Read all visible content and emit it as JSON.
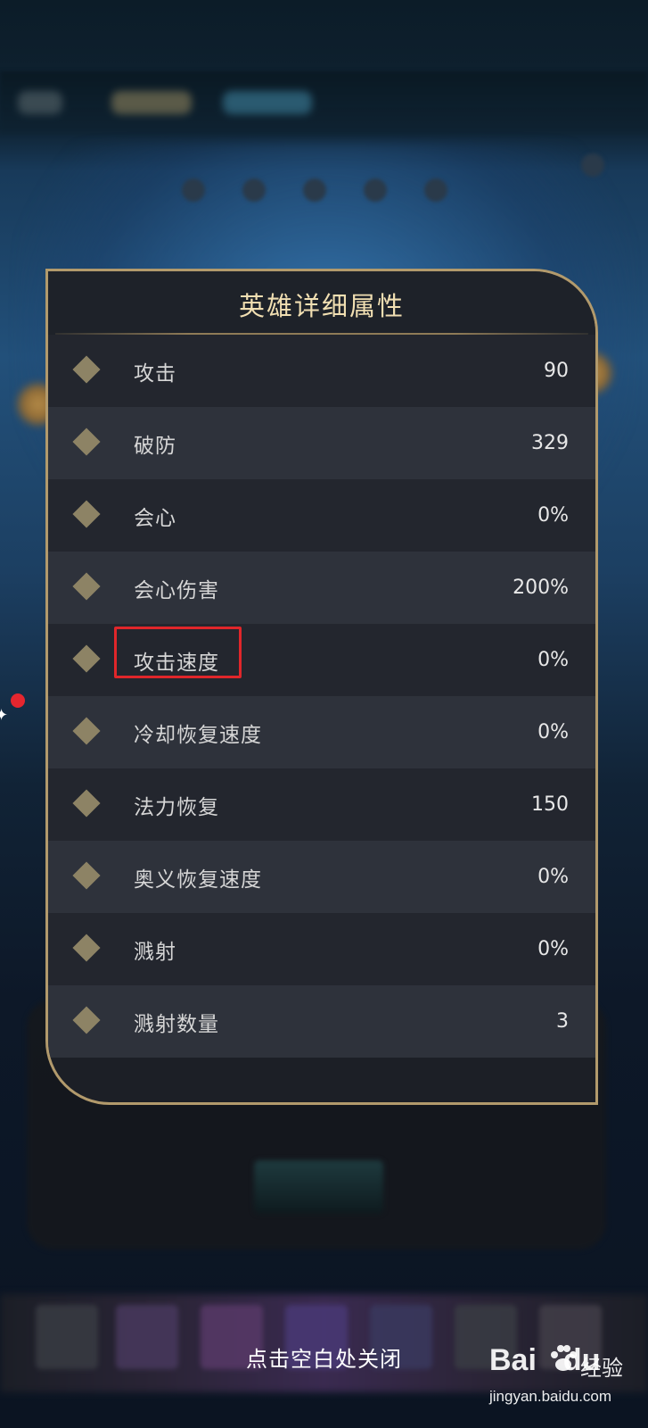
{
  "panel": {
    "title": "英雄详细属性",
    "rows": [
      {
        "label": "攻击",
        "value": "90"
      },
      {
        "label": "破防",
        "value": "329"
      },
      {
        "label": "会心",
        "value": "0%"
      },
      {
        "label": "会心伤害",
        "value": "200%"
      },
      {
        "label": "攻击速度",
        "value": "0%"
      },
      {
        "label": "冷却恢复速度",
        "value": "0%"
      },
      {
        "label": "法力恢复",
        "value": "150"
      },
      {
        "label": "奥义恢复速度",
        "value": "0%"
      },
      {
        "label": "溅射",
        "value": "0%"
      },
      {
        "label": "溅射数量",
        "value": "3"
      }
    ],
    "highlighted_row": "攻击速度"
  },
  "close_hint": "点击空白处关闭",
  "watermark": {
    "brand": "Bai",
    "brand_suffix": "du",
    "sub": "经验",
    "url": "jingyan.baidu.com"
  },
  "colors": {
    "panel_border": "#b29a6c",
    "title": "#f1dfb2",
    "row_odd": "#23262e",
    "row_even": "#2e323b",
    "diamond": "#8d8365",
    "highlight": "#e0262a"
  }
}
